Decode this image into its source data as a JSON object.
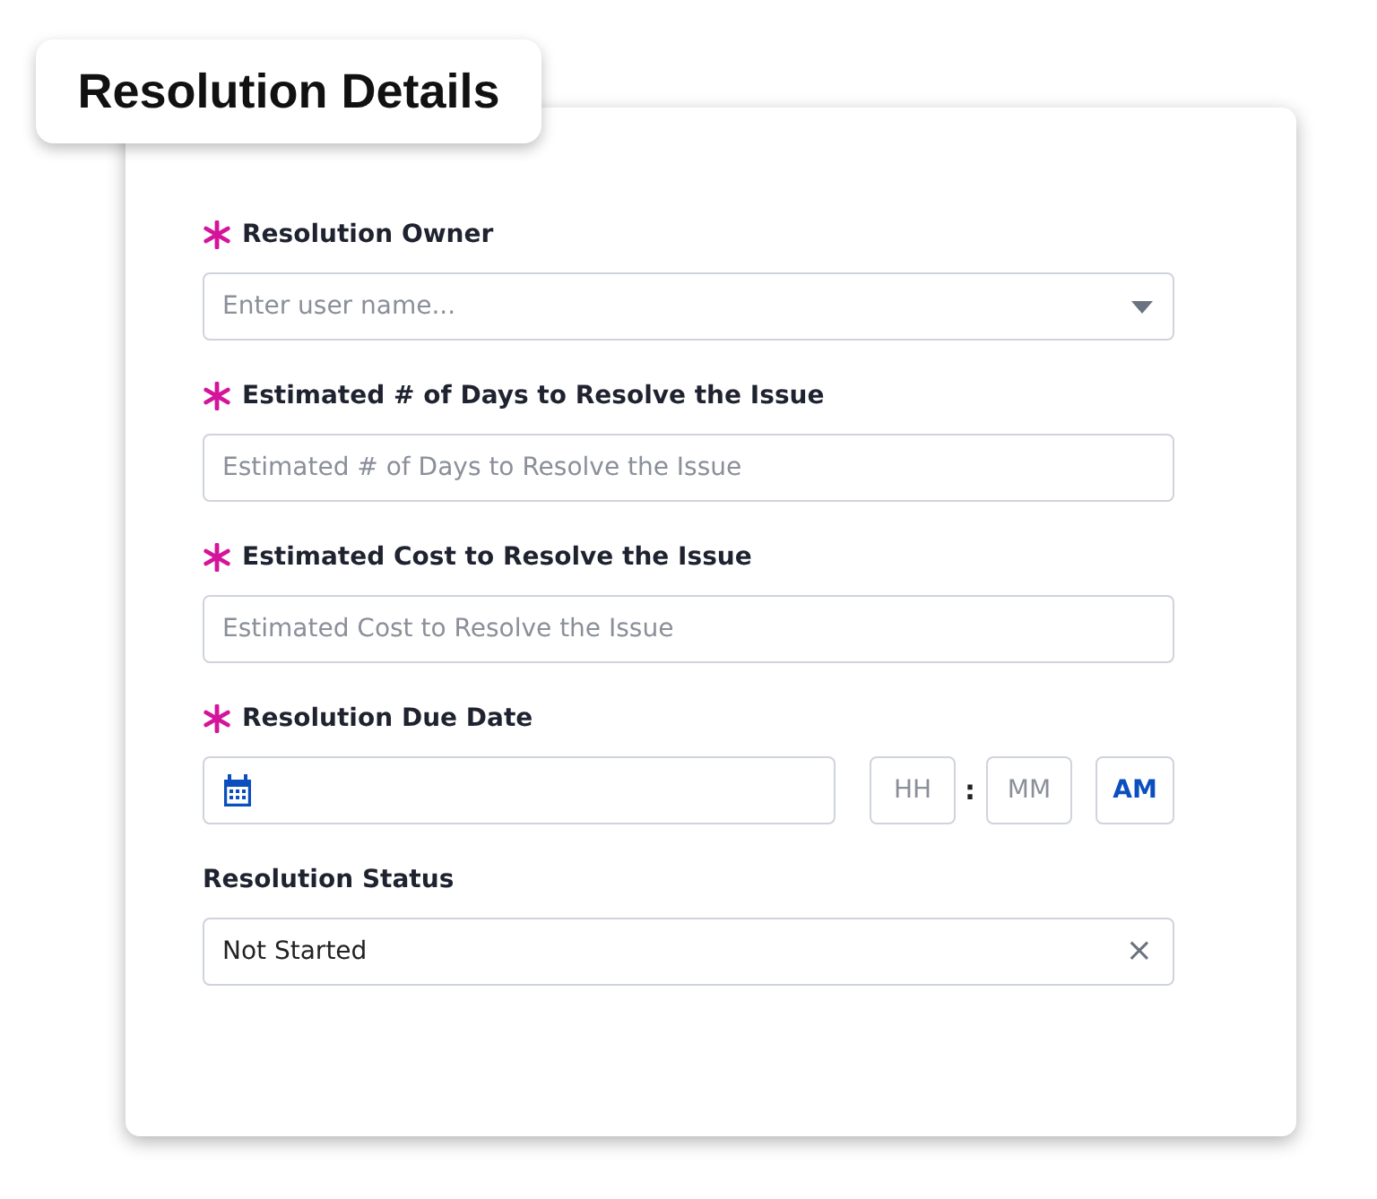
{
  "title": "Resolution Details",
  "fields": [
    {
      "kind": "dropdown",
      "label": "Resolution Owner",
      "required": true,
      "placeholder": "Enter user name..."
    },
    {
      "kind": "text",
      "label": "Estimated # of Days to Resolve the Issue",
      "required": true,
      "placeholder": "Estimated # of Days to Resolve the Issue"
    },
    {
      "kind": "text",
      "label": "Estimated Cost to Resolve the Issue",
      "required": true,
      "placeholder": "Estimated Cost to Resolve the Issue"
    },
    {
      "kind": "datetime",
      "label": "Resolution Due Date",
      "required": true,
      "hour_placeholder": "HH",
      "separator": ":",
      "minute_placeholder": "MM",
      "period": "AM"
    },
    {
      "kind": "clearable",
      "label": "Resolution Status",
      "required": false,
      "value": "Not Started",
      "clear": "×"
    }
  ]
}
